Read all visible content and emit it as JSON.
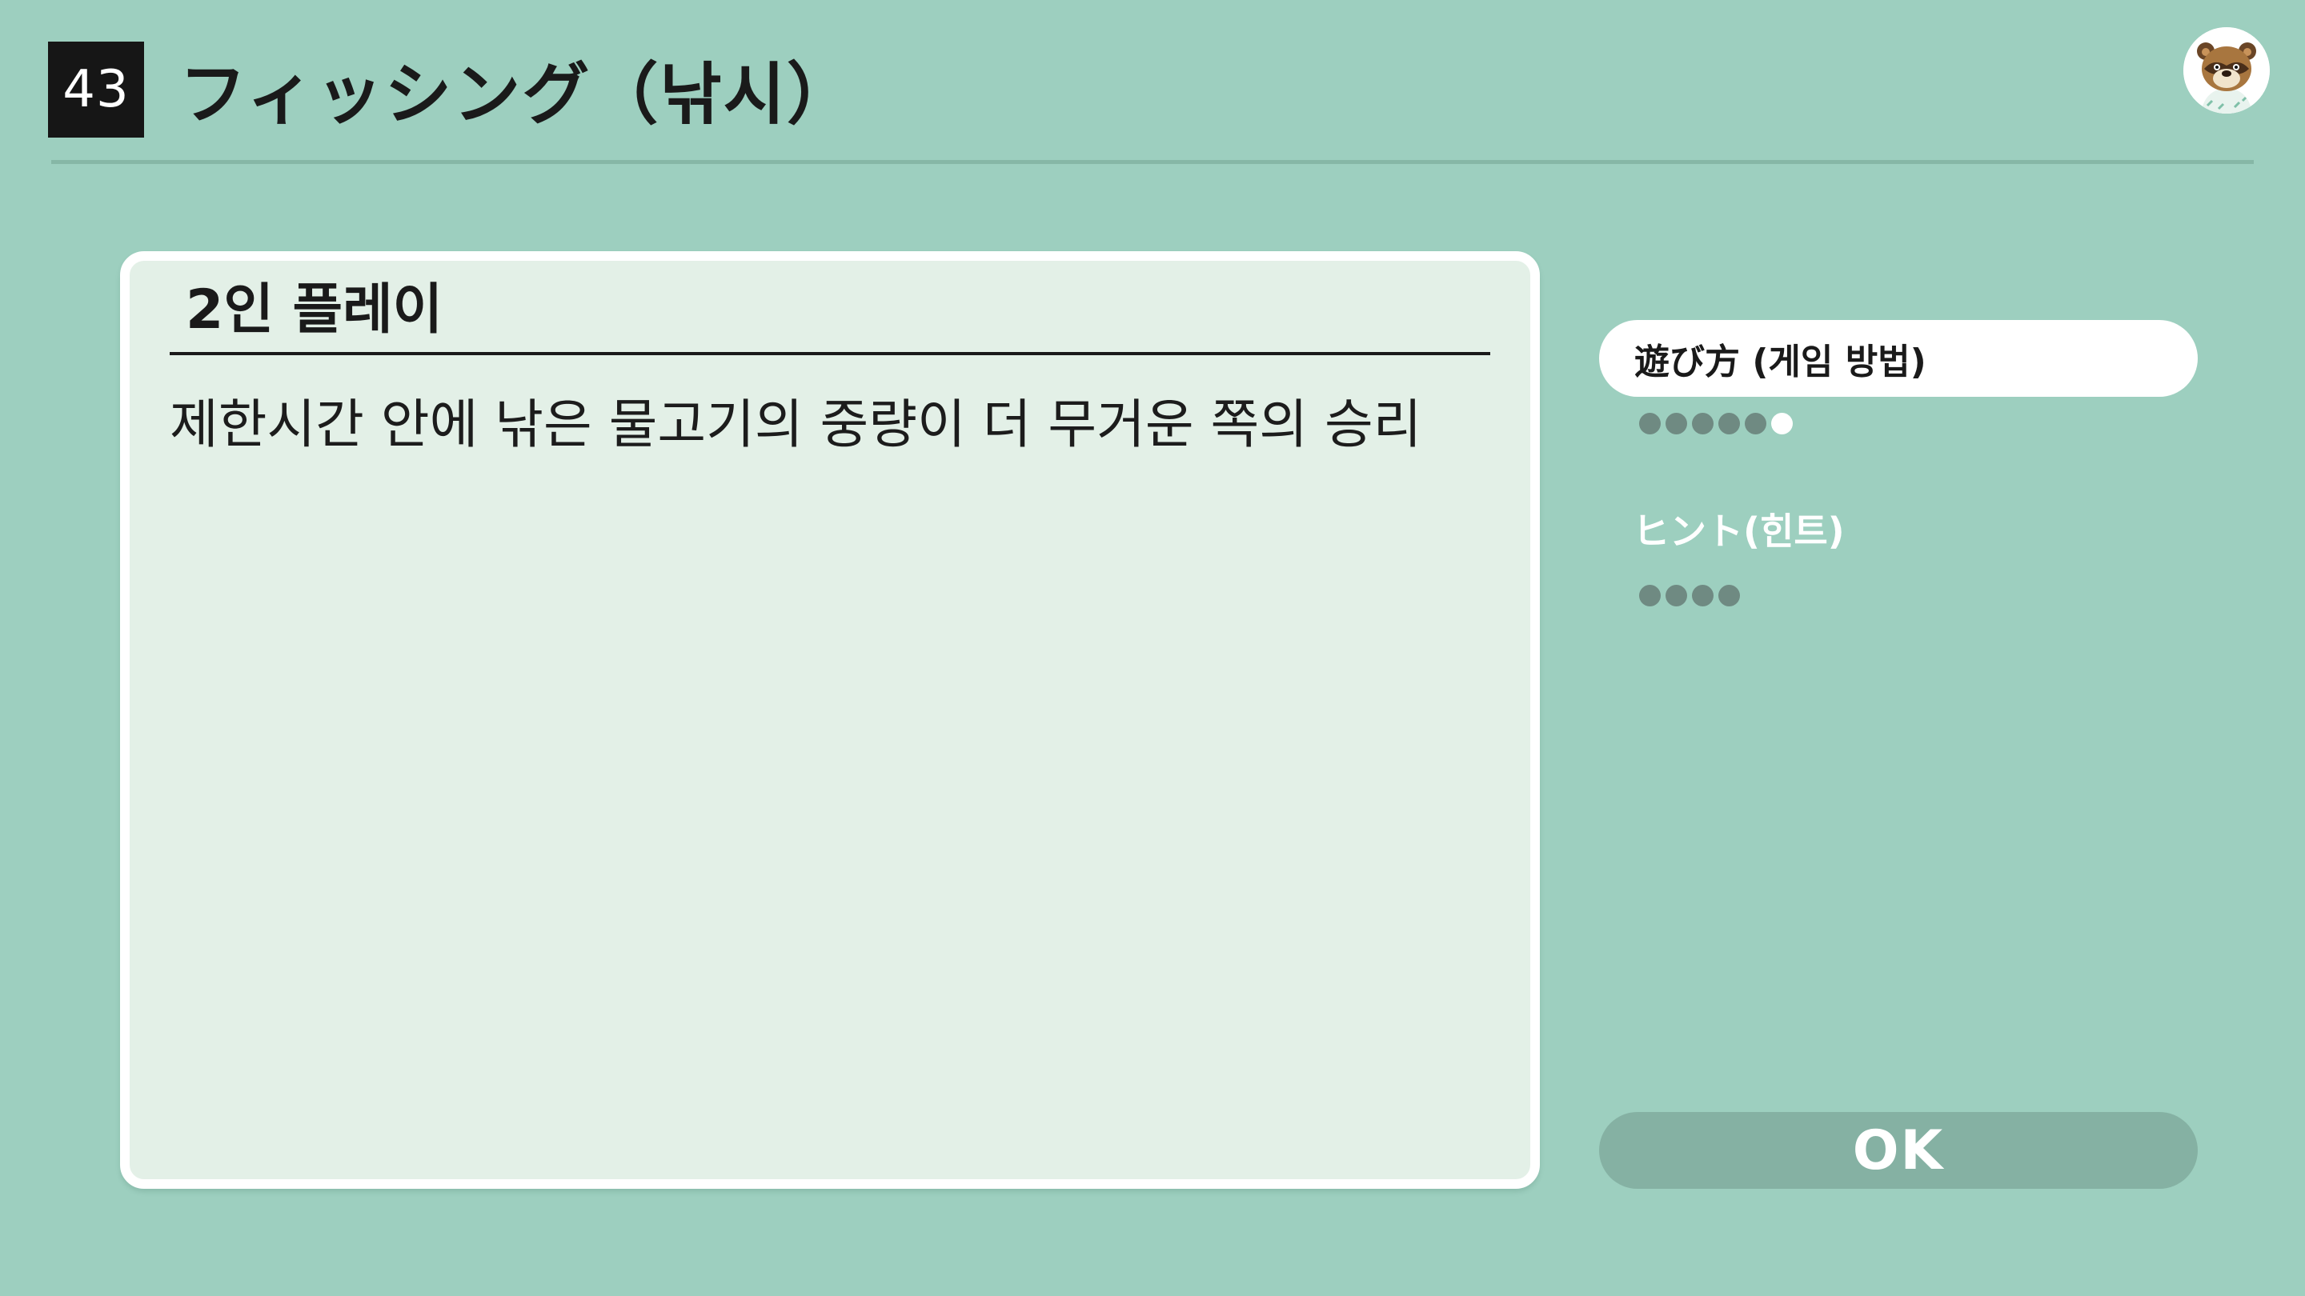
{
  "header": {
    "number": "43",
    "title": "フィッシング（낚시）"
  },
  "panel": {
    "heading": "2인 플레이",
    "body": "제한시간 안에 낚은 물고기의 중량이 더 무거운 쪽의 승리"
  },
  "tabs": [
    {
      "label": "遊び方 (게임 방법)",
      "pages": 6,
      "current_page": 6
    },
    {
      "label": "ヒント(힌트)",
      "pages": 4
    }
  ],
  "ok_button": {
    "label": "OK"
  },
  "colors": {
    "background": "#9dcfbf",
    "panel": "#e3f0e7",
    "badge": "#161616",
    "ok_button": "#85b1a3",
    "dot": "#6f8a82"
  }
}
